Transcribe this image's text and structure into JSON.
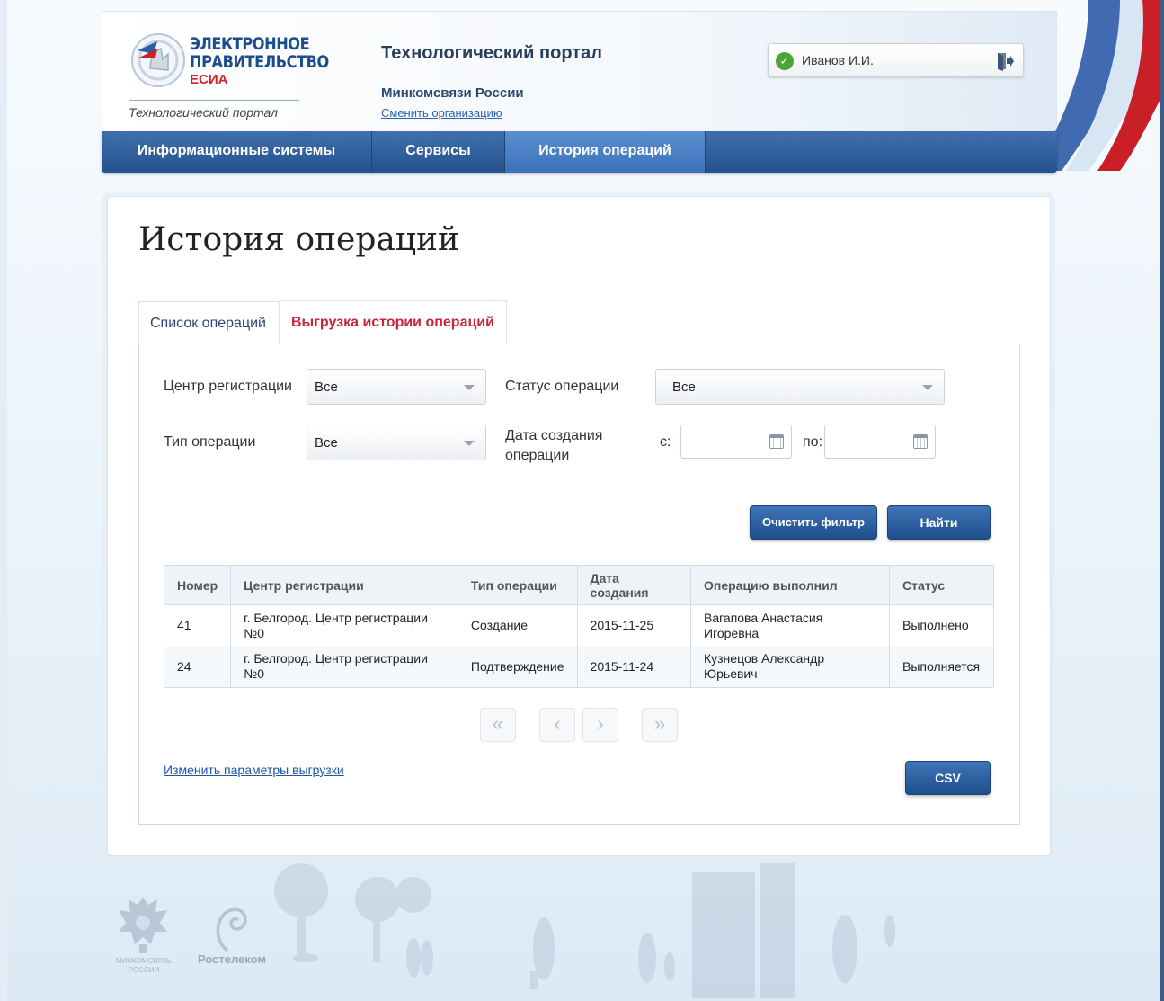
{
  "header": {
    "logo_line1": "ЭЛЕКТРОННОЕ",
    "logo_line2": "ПРАВИТЕЛЬСТВО",
    "logo_esia": "ЕСИА",
    "logo_subtitle": "Технологический портал",
    "portal_title": "Технологический портал",
    "organization": "Минкомсвязи России",
    "change_org_link": "Сменить организацию",
    "user_name": "Иванов И.И."
  },
  "nav": {
    "items": [
      {
        "label": "Информационные системы",
        "active": false
      },
      {
        "label": "Сервисы",
        "active": false
      },
      {
        "label": "История операций",
        "active": true
      }
    ]
  },
  "page": {
    "title": "История операций",
    "tabs": [
      {
        "label": "Список операций",
        "active": false
      },
      {
        "label": "Выгрузка истории операций",
        "active": true
      }
    ]
  },
  "filters": {
    "center_label": "Центр регистрации",
    "center_value": "Все",
    "status_label": "Статус операции",
    "status_value": "Все",
    "type_label": "Тип операции",
    "type_value": "Все",
    "date_label": "Дата создания операции",
    "date_from_label": "с:",
    "date_to_label": "по:",
    "date_from_value": "",
    "date_to_value": "",
    "clear_button": "Очистить фильтр",
    "find_button": "Найти"
  },
  "table": {
    "columns": [
      "Номер",
      "Центр регистрации",
      "Тип операции",
      "Дата создания",
      "Операцию выполнил",
      "Статус"
    ],
    "rows": [
      [
        "41",
        "г. Белгород. Центр регистрации №0",
        "Создание",
        "2015-11-25",
        "Вагапова Анастасия Игоревна",
        "Выполнено"
      ],
      [
        "24",
        "г. Белгород. Центр регистрации №0",
        "Подтверждение",
        "2015-11-24",
        "Кузнецов Александр Юрьевич",
        "Выполняется"
      ]
    ]
  },
  "pagination": {
    "first": "«",
    "prev": "‹",
    "next": "›",
    "last": "»"
  },
  "actions": {
    "change_params_link": "Изменить параметры выгрузки",
    "csv_button": "CSV"
  },
  "footer": {
    "minsvyaz": "МИНКОМСВЯЗЬ РОССИИ",
    "rostelecom": "Ростелеком"
  },
  "colors": {
    "nav_blue": "#24528f",
    "active_tab_red": "#c8253a",
    "button_blue": "#1f4f8e",
    "link_blue": "#1e56a6"
  }
}
